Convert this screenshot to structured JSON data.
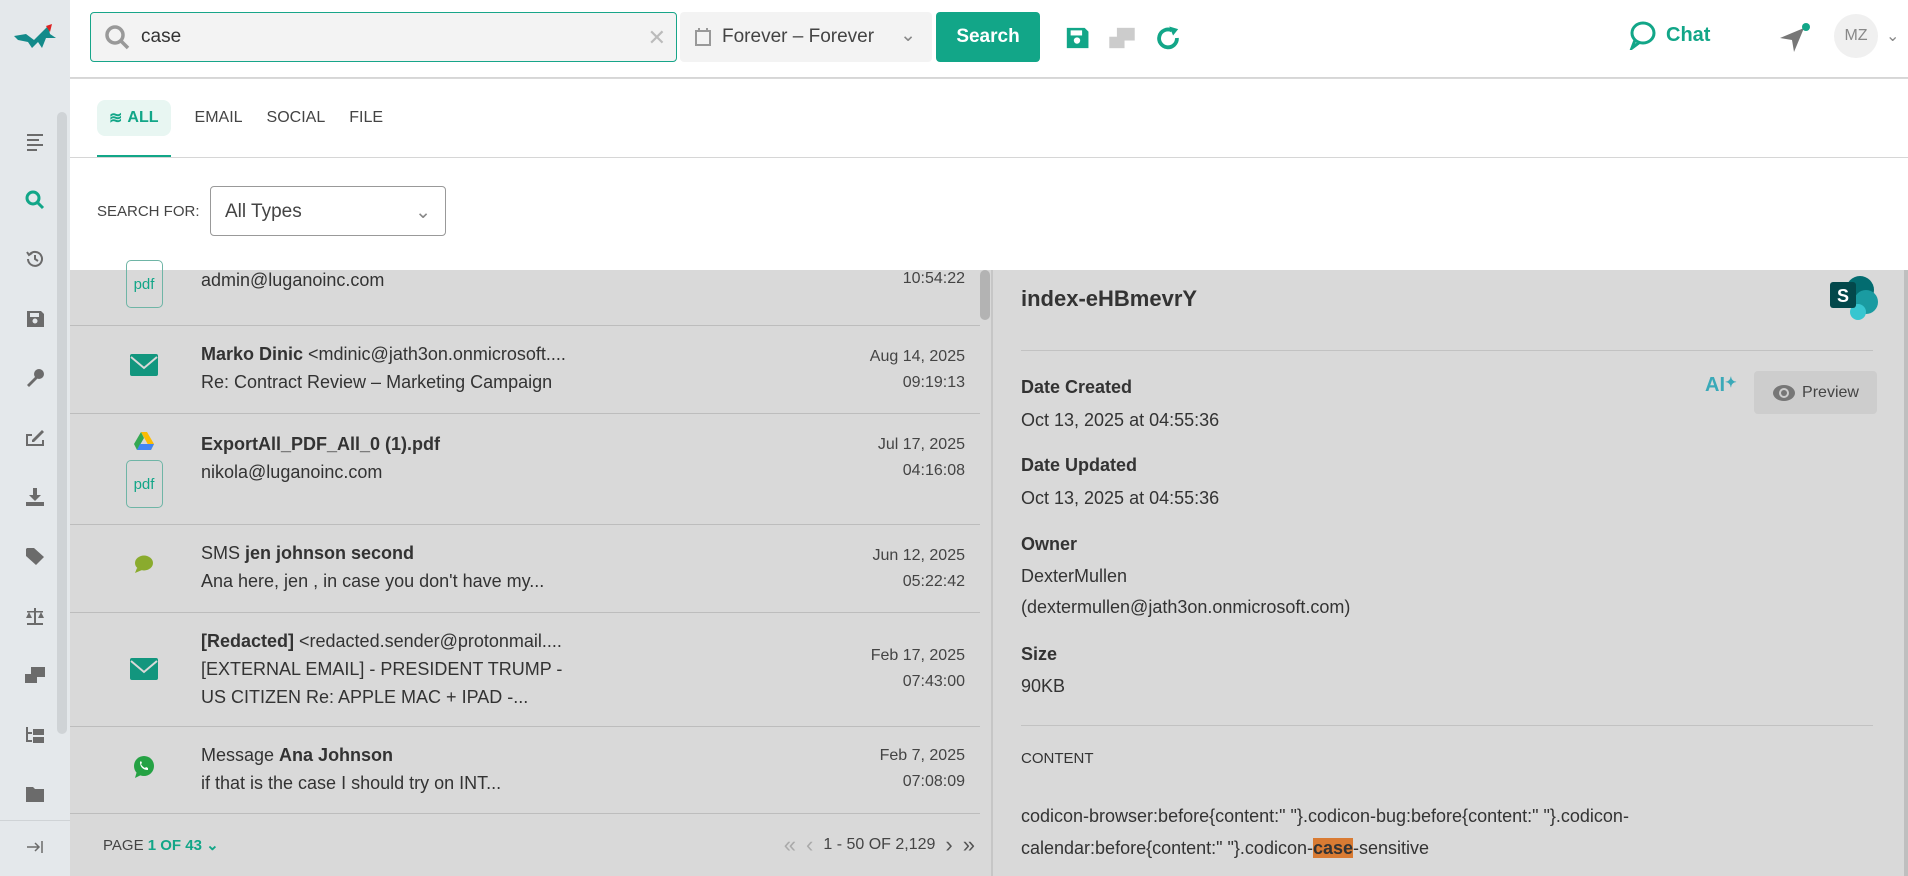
{
  "sidebar": {
    "items": [
      {
        "icon": "list-icon"
      },
      {
        "icon": "search-icon",
        "active": true
      },
      {
        "icon": "history-icon"
      },
      {
        "icon": "save-icon"
      },
      {
        "icon": "key-icon"
      },
      {
        "icon": "signature-icon"
      },
      {
        "icon": "download-icon"
      },
      {
        "icon": "tag-icon"
      },
      {
        "icon": "scale-icon"
      },
      {
        "icon": "mail-card-icon"
      },
      {
        "icon": "tree-icon"
      },
      {
        "icon": "folder-icon"
      }
    ],
    "collapse_icon": "collapse-right-icon"
  },
  "topbar": {
    "search_value": "case",
    "date_range": "Forever – Forever",
    "search_label": "Search",
    "chat_label": "Chat",
    "avatar_initials": "MZ",
    "accent": "#12a688"
  },
  "filters": {
    "tabs": [
      {
        "label": "ALL",
        "active": true
      },
      {
        "label": "EMAIL"
      },
      {
        "label": "SOCIAL"
      },
      {
        "label": "FILE"
      }
    ],
    "search_for_label": "SEARCH FOR:",
    "search_for_value": "All Types"
  },
  "results": [
    {
      "type": "pdf",
      "line1": "admin@luganoinc.com",
      "date": "",
      "time": "10:54:22"
    },
    {
      "type": "email",
      "bold": "Marko Dinic",
      "rest": " <mdinic@jath3on.onmicrosoft....",
      "line2": "Re: Contract Review – Marketing Campaign",
      "date": "Aug 14, 2025",
      "time": "09:19:13"
    },
    {
      "type": "gdrive-pdf",
      "bold": "ExportAll_PDF_All_0 (1).pdf",
      "rest": "",
      "line2": "nikola@luganoinc.com",
      "date": "Jul 17, 2025",
      "time": "04:16:08"
    },
    {
      "type": "sms",
      "prefix": "SMS ",
      "bold": "jen johnson second",
      "line2": "Ana here, jen , in case you don't have my...",
      "date": "Jun 12, 2025",
      "time": "05:22:42"
    },
    {
      "type": "email",
      "bold": "[Redacted]",
      "rest": " <redacted.sender@protonmail....",
      "line2": "[EXTERNAL EMAIL] - PRESIDENT TRUMP -",
      "line3": "US CITIZEN Re: APPLE MAC + IPAD -...",
      "date": "Feb 17, 2025",
      "time": "07:43:00"
    },
    {
      "type": "whatsapp",
      "prefix": "Message ",
      "bold": "Ana Johnson",
      "line2": "if that is the case I should try on INT...",
      "date": "Feb 7, 2025",
      "time": "07:08:09"
    }
  ],
  "pagination": {
    "page_label": "PAGE",
    "page_value": "1 OF 43",
    "range": "1 - 50 OF 2,129"
  },
  "detail": {
    "title": "index-eHBmevrY",
    "ai_label": "AI",
    "preview_label": "Preview",
    "fields": [
      {
        "label": "Date Created",
        "value": "Oct 13, 2025 at 04:55:36"
      },
      {
        "label": "Date Updated",
        "value": "Oct 13, 2025 at 04:55:36"
      },
      {
        "label": "Owner",
        "value": "DexterMullen",
        "value2": "(dextermullen@jath3on.onmicrosoft.com)"
      },
      {
        "label": "Size",
        "value": "90KB"
      }
    ],
    "content_label": "CONTENT",
    "content_before": "codicon-browser:before{content:\"  \"}.codicon-bug:before{content:\"  \"}.codicon-calendar:before{content:\"  \"}.codicon-",
    "content_highlight": "case",
    "content_after": "-sensitive"
  }
}
